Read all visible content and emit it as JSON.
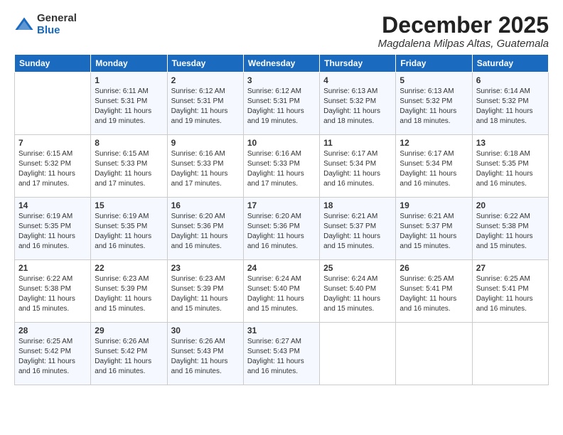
{
  "logo": {
    "general": "General",
    "blue": "Blue"
  },
  "title": "December 2025",
  "location": "Magdalena Milpas Altas, Guatemala",
  "days_of_week": [
    "Sunday",
    "Monday",
    "Tuesday",
    "Wednesday",
    "Thursday",
    "Friday",
    "Saturday"
  ],
  "weeks": [
    [
      {
        "day": "",
        "info": ""
      },
      {
        "day": "1",
        "info": "Sunrise: 6:11 AM\nSunset: 5:31 PM\nDaylight: 11 hours\nand 19 minutes."
      },
      {
        "day": "2",
        "info": "Sunrise: 6:12 AM\nSunset: 5:31 PM\nDaylight: 11 hours\nand 19 minutes."
      },
      {
        "day": "3",
        "info": "Sunrise: 6:12 AM\nSunset: 5:31 PM\nDaylight: 11 hours\nand 19 minutes."
      },
      {
        "day": "4",
        "info": "Sunrise: 6:13 AM\nSunset: 5:32 PM\nDaylight: 11 hours\nand 18 minutes."
      },
      {
        "day": "5",
        "info": "Sunrise: 6:13 AM\nSunset: 5:32 PM\nDaylight: 11 hours\nand 18 minutes."
      },
      {
        "day": "6",
        "info": "Sunrise: 6:14 AM\nSunset: 5:32 PM\nDaylight: 11 hours\nand 18 minutes."
      }
    ],
    [
      {
        "day": "7",
        "info": "Sunrise: 6:15 AM\nSunset: 5:32 PM\nDaylight: 11 hours\nand 17 minutes."
      },
      {
        "day": "8",
        "info": "Sunrise: 6:15 AM\nSunset: 5:33 PM\nDaylight: 11 hours\nand 17 minutes."
      },
      {
        "day": "9",
        "info": "Sunrise: 6:16 AM\nSunset: 5:33 PM\nDaylight: 11 hours\nand 17 minutes."
      },
      {
        "day": "10",
        "info": "Sunrise: 6:16 AM\nSunset: 5:33 PM\nDaylight: 11 hours\nand 17 minutes."
      },
      {
        "day": "11",
        "info": "Sunrise: 6:17 AM\nSunset: 5:34 PM\nDaylight: 11 hours\nand 16 minutes."
      },
      {
        "day": "12",
        "info": "Sunrise: 6:17 AM\nSunset: 5:34 PM\nDaylight: 11 hours\nand 16 minutes."
      },
      {
        "day": "13",
        "info": "Sunrise: 6:18 AM\nSunset: 5:35 PM\nDaylight: 11 hours\nand 16 minutes."
      }
    ],
    [
      {
        "day": "14",
        "info": "Sunrise: 6:19 AM\nSunset: 5:35 PM\nDaylight: 11 hours\nand 16 minutes."
      },
      {
        "day": "15",
        "info": "Sunrise: 6:19 AM\nSunset: 5:35 PM\nDaylight: 11 hours\nand 16 minutes."
      },
      {
        "day": "16",
        "info": "Sunrise: 6:20 AM\nSunset: 5:36 PM\nDaylight: 11 hours\nand 16 minutes."
      },
      {
        "day": "17",
        "info": "Sunrise: 6:20 AM\nSunset: 5:36 PM\nDaylight: 11 hours\nand 16 minutes."
      },
      {
        "day": "18",
        "info": "Sunrise: 6:21 AM\nSunset: 5:37 PM\nDaylight: 11 hours\nand 15 minutes."
      },
      {
        "day": "19",
        "info": "Sunrise: 6:21 AM\nSunset: 5:37 PM\nDaylight: 11 hours\nand 15 minutes."
      },
      {
        "day": "20",
        "info": "Sunrise: 6:22 AM\nSunset: 5:38 PM\nDaylight: 11 hours\nand 15 minutes."
      }
    ],
    [
      {
        "day": "21",
        "info": "Sunrise: 6:22 AM\nSunset: 5:38 PM\nDaylight: 11 hours\nand 15 minutes."
      },
      {
        "day": "22",
        "info": "Sunrise: 6:23 AM\nSunset: 5:39 PM\nDaylight: 11 hours\nand 15 minutes."
      },
      {
        "day": "23",
        "info": "Sunrise: 6:23 AM\nSunset: 5:39 PM\nDaylight: 11 hours\nand 15 minutes."
      },
      {
        "day": "24",
        "info": "Sunrise: 6:24 AM\nSunset: 5:40 PM\nDaylight: 11 hours\nand 15 minutes."
      },
      {
        "day": "25",
        "info": "Sunrise: 6:24 AM\nSunset: 5:40 PM\nDaylight: 11 hours\nand 15 minutes."
      },
      {
        "day": "26",
        "info": "Sunrise: 6:25 AM\nSunset: 5:41 PM\nDaylight: 11 hours\nand 16 minutes."
      },
      {
        "day": "27",
        "info": "Sunrise: 6:25 AM\nSunset: 5:41 PM\nDaylight: 11 hours\nand 16 minutes."
      }
    ],
    [
      {
        "day": "28",
        "info": "Sunrise: 6:25 AM\nSunset: 5:42 PM\nDaylight: 11 hours\nand 16 minutes."
      },
      {
        "day": "29",
        "info": "Sunrise: 6:26 AM\nSunset: 5:42 PM\nDaylight: 11 hours\nand 16 minutes."
      },
      {
        "day": "30",
        "info": "Sunrise: 6:26 AM\nSunset: 5:43 PM\nDaylight: 11 hours\nand 16 minutes."
      },
      {
        "day": "31",
        "info": "Sunrise: 6:27 AM\nSunset: 5:43 PM\nDaylight: 11 hours\nand 16 minutes."
      },
      {
        "day": "",
        "info": ""
      },
      {
        "day": "",
        "info": ""
      },
      {
        "day": "",
        "info": ""
      }
    ]
  ]
}
